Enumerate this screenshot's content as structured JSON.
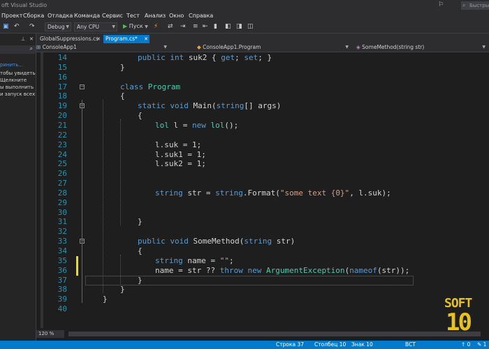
{
  "window": {
    "title": "oft Visual Studio",
    "notification_icon": "bell-icon",
    "quick_launch_placeholder": "Быстрый за"
  },
  "menu": [
    "Проект",
    "Сборка",
    "Отладка",
    "Команда",
    "Сервис",
    "Тест",
    "Анализ",
    "Окно",
    "Справка"
  ],
  "toolbar": {
    "configuration": "Debug",
    "platform": "Any CPU",
    "run_label": "Пуск"
  },
  "solution_pane": {
    "hint_lines": [
      "ринить...",
      "тобы увидеть",
      "Щелкните",
      "ы выполнить",
      "и запуск всех"
    ]
  },
  "tabs": [
    {
      "label": "GlobalSuppressions.cs",
      "active": false
    },
    {
      "label": "Program.cs*",
      "active": true
    }
  ],
  "navbar": {
    "project": "ConsoleApp1",
    "type": "ConsoleApp1.Program",
    "member": "SomeMethod(string str)"
  },
  "editor": {
    "lines": [
      {
        "n": "14",
        "text": "public int suk2 { get; set; }"
      },
      {
        "n": "15",
        "text": "}"
      },
      {
        "n": "16",
        "text": ""
      },
      {
        "n": "17",
        "text": "class Program"
      },
      {
        "n": "18",
        "text": "{"
      },
      {
        "n": "19",
        "text": "static void Main(string[] args)"
      },
      {
        "n": "20",
        "text": "{"
      },
      {
        "n": "21",
        "text": "lol l = new lol();"
      },
      {
        "n": "22",
        "text": ""
      },
      {
        "n": "23",
        "text": "l.suk = 1;"
      },
      {
        "n": "24",
        "text": "l.suk1 = 1;"
      },
      {
        "n": "25",
        "text": "l.suk2 = 1;"
      },
      {
        "n": "26",
        "text": ""
      },
      {
        "n": "27",
        "text": ""
      },
      {
        "n": "28",
        "text": "string str = string.Format(\"some text {0}\", l.suk);"
      },
      {
        "n": "29",
        "text": ""
      },
      {
        "n": "30",
        "text": ""
      },
      {
        "n": "31",
        "text": "}"
      },
      {
        "n": "32",
        "text": ""
      },
      {
        "n": "33",
        "text": "public void SomeMethod(string str)"
      },
      {
        "n": "34",
        "text": "{"
      },
      {
        "n": "35",
        "text": "string name = \"\";"
      },
      {
        "n": "36",
        "text": "name = str ?? throw new ArgumentException(nameof(str));"
      },
      {
        "n": "37",
        "text": "}"
      },
      {
        "n": "38",
        "text": "}"
      },
      {
        "n": "39",
        "text": "}"
      },
      {
        "n": "40",
        "text": ""
      }
    ]
  },
  "status": {
    "zoom": "120 %",
    "row": "Строка 37",
    "column": "Столбец 10",
    "char": "Знак 10",
    "mode": "ВСТ",
    "changes": "↑ 0",
    "pen": "✎ 1"
  },
  "watermark": {
    "line1": "SOFT",
    "line2": "10"
  },
  "colors": {
    "accent": "#007acc",
    "keyword": "#569cd6",
    "type": "#4ec9b0",
    "string": "#d69d85",
    "line_number": "#2b91af",
    "change_bar": "#f0e000",
    "watermark": "#e8c11a"
  }
}
